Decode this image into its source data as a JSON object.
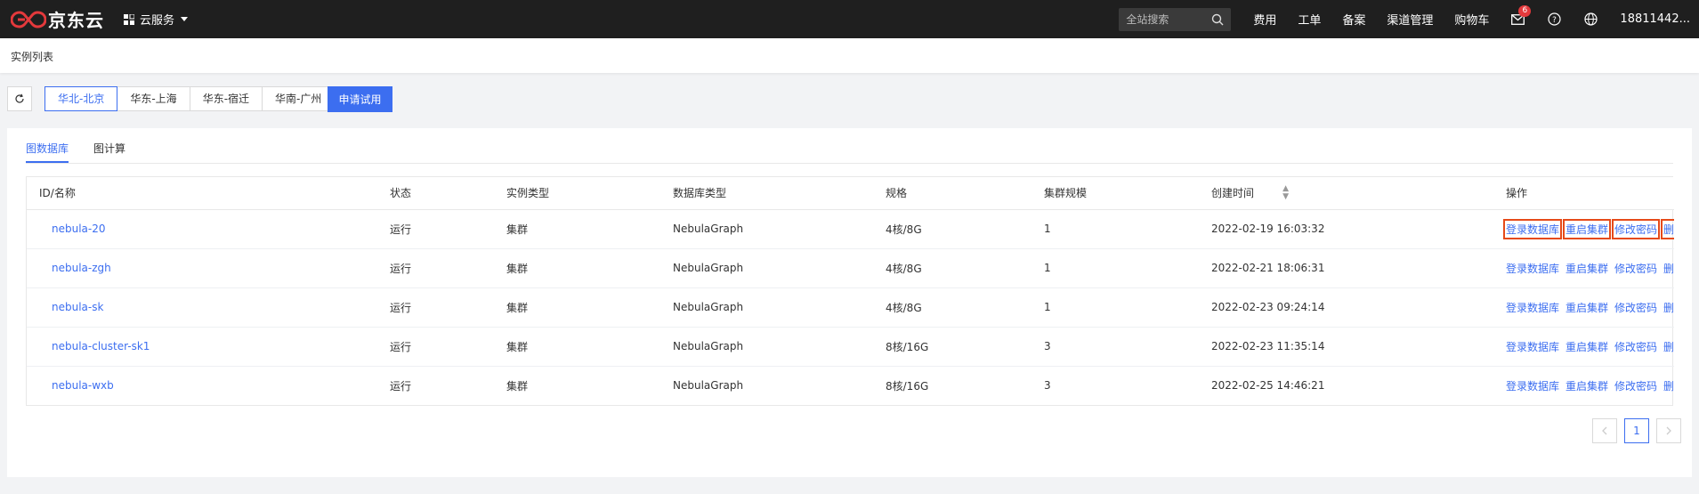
{
  "brand": {
    "name": "京东云",
    "logo_color": "#e4393c"
  },
  "header": {
    "service_menu": "云服务",
    "search_placeholder": "全站搜索",
    "links": [
      "费用",
      "工单",
      "备案",
      "渠道管理",
      "购物车"
    ],
    "message_count": "6",
    "username": "18811442..."
  },
  "breadcrumb": "实例列表",
  "regions": {
    "items": [
      "华北-北京",
      "华东-上海",
      "华东-宿迁",
      "华南-广州"
    ],
    "active_index": 0
  },
  "trial_button": "申请试用",
  "tabs": {
    "items": [
      "图数据库",
      "图计算"
    ],
    "active_index": 0
  },
  "table": {
    "columns": [
      "ID/名称",
      "状态",
      "实例类型",
      "数据库类型",
      "规格",
      "集群规模",
      "创建时间",
      "操作"
    ],
    "action_labels": [
      "登录数据库",
      "重启集群",
      "修改密码",
      "删除"
    ],
    "rows": [
      {
        "name": "nebula-20",
        "status": "运行",
        "type": "集群",
        "db": "NebulaGraph",
        "spec": "4核/8G",
        "size": "1",
        "created": "2022-02-19 16:03:32",
        "highlighted": true
      },
      {
        "name": "nebula-zgh",
        "status": "运行",
        "type": "集群",
        "db": "NebulaGraph",
        "spec": "4核/8G",
        "size": "1",
        "created": "2022-02-21 18:06:31",
        "highlighted": false
      },
      {
        "name": "nebula-sk",
        "status": "运行",
        "type": "集群",
        "db": "NebulaGraph",
        "spec": "4核/8G",
        "size": "1",
        "created": "2022-02-23 09:24:14",
        "highlighted": false
      },
      {
        "name": "nebula-cluster-sk1",
        "status": "运行",
        "type": "集群",
        "db": "NebulaGraph",
        "spec": "8核/16G",
        "size": "3",
        "created": "2022-02-23 11:35:14",
        "highlighted": false
      },
      {
        "name": "nebula-wxb",
        "status": "运行",
        "type": "集群",
        "db": "NebulaGraph",
        "spec": "8核/16G",
        "size": "3",
        "created": "2022-02-25 14:46:21",
        "highlighted": false
      }
    ]
  },
  "pagination": {
    "current": "1"
  },
  "colors": {
    "accent": "#3c6ef0",
    "topbar": "#1f1f1f",
    "highlight": "#e64a19"
  }
}
